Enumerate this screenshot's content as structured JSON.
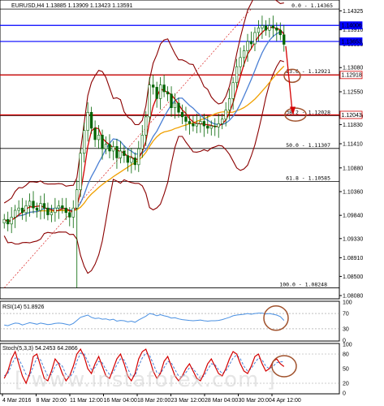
{
  "chart_data": [
    {
      "type": "candlestick",
      "title": "EURUSD,H4  1.13885 1.13909 1.13423 1.13591",
      "ylim": [
        1.0808,
        1.1442
      ],
      "y_ticks": [
        "1.14325",
        "1.13910",
        "1.13590",
        "1.13080",
        "1.12550",
        "1.12020",
        "1.11830",
        "1.11410",
        "1.10880",
        "1.10360",
        "1.09840",
        "1.09330",
        "1.08910",
        "1.08500",
        "1.08080"
      ],
      "x_ticks": [
        "4 Mar 2016",
        "8 Mar 20:00",
        "11 Mar 12:00",
        "16 Mar 04:00",
        "18 Mar 20:00",
        "23 Mar 12:00",
        "28 Mar 04:00",
        "30 Mar 20:00",
        "4 Apr 12:00"
      ],
      "price_labels": [
        {
          "text": "1.14006",
          "value": 1.14006,
          "color": "#0000ff"
        },
        {
          "text": "1.13653",
          "value": 1.13653,
          "color": "#0000ff"
        },
        {
          "text": "1.12918",
          "value": 1.12918,
          "color": "#d40000"
        },
        {
          "text": "1.12043",
          "value": 1.12043,
          "color": "#d40000"
        }
      ],
      "fibonacci_levels": [
        {
          "text": "0.0 - 1.14365",
          "value": 1.14365
        },
        {
          "text": "23.6 - 1.12921",
          "value": 1.12921
        },
        {
          "text": "38.2 - 1.12028",
          "value": 1.12028
        },
        {
          "text": "50.0 - 1.11307",
          "value": 1.11307
        },
        {
          "text": "61.8 - 1.10585",
          "value": 1.10585
        },
        {
          "text": "100.0 - 1.08248",
          "value": 1.08248
        }
      ],
      "candles": {
        "close": [
          1.0975,
          1.0965,
          1.098,
          1.0995,
          1.1,
          1.099,
          1.1005,
          1.1015,
          1.1,
          1.0995,
          1.101,
          1.1,
          1.0985,
          1.099,
          1.1,
          1.1005,
          1.1,
          1.099,
          1.098,
          1.1,
          1.104,
          1.112,
          1.117,
          1.121,
          1.1175,
          1.115,
          1.116,
          1.113,
          1.114,
          1.1125,
          1.1135,
          1.111,
          1.1125,
          1.1115,
          1.11,
          1.111,
          1.1095,
          1.113,
          1.116,
          1.12,
          1.127,
          1.1265,
          1.124,
          1.127,
          1.1255,
          1.125,
          1.122,
          1.123,
          1.121,
          1.12,
          1.119,
          1.1185,
          1.118,
          1.1185,
          1.119,
          1.118,
          1.1175,
          1.118,
          1.1178,
          1.1185,
          1.1195,
          1.1215,
          1.124,
          1.1275,
          1.131,
          1.133,
          1.1345,
          1.1365,
          1.136,
          1.1385,
          1.1395,
          1.14,
          1.139,
          1.14,
          1.1395,
          1.139,
          1.138,
          1.1359
        ],
        "high_low_range": [
          1.0825,
          1.14365
        ]
      },
      "indicators": [
        "Bollinger Bands",
        "Moving averages"
      ],
      "annotations": [
        "circle near 1.1290",
        "circle near 1.1205",
        "down arrow to 1.1205"
      ]
    },
    {
      "type": "line",
      "title": "RSI(14) 51.8926",
      "ylim": [
        0,
        100
      ],
      "y_ticks": [
        "100",
        "70",
        "30",
        "0"
      ],
      "values": [
        40,
        38,
        42,
        45,
        44,
        40,
        43,
        46,
        44,
        42,
        45,
        43,
        41,
        42,
        44,
        45,
        44,
        42,
        40,
        44,
        52,
        60,
        63,
        66,
        60,
        57,
        58,
        55,
        56,
        53,
        55,
        50,
        52,
        51,
        48,
        50,
        47,
        53,
        58,
        63,
        70,
        68,
        64,
        67,
        64,
        62,
        58,
        59,
        56,
        54,
        53,
        52,
        51,
        52,
        53,
        51,
        50,
        51,
        51,
        52,
        54,
        57,
        60,
        64,
        66,
        67,
        68,
        70,
        68,
        70,
        71,
        71,
        69,
        70,
        68,
        66,
        62,
        51.89
      ]
    },
    {
      "type": "line",
      "title": "Stoch(5,3,3) 54.2453 64.2866",
      "ylim": [
        0,
        100
      ],
      "y_ticks": [
        "100",
        "80",
        "50",
        "20",
        "0"
      ],
      "series": [
        {
          "name": "%K",
          "values": [
            30,
            45,
            70,
            85,
            60,
            35,
            20,
            40,
            75,
            80,
            55,
            30,
            25,
            45,
            70,
            60,
            40,
            25,
            35,
            55,
            80,
            90,
            75,
            50,
            40,
            60,
            75,
            55,
            35,
            30,
            50,
            70,
            80,
            60,
            35,
            25,
            40,
            70,
            85,
            90,
            70,
            45,
            30,
            40,
            65,
            75,
            55,
            35,
            25,
            35,
            50,
            60,
            45,
            30,
            25,
            40,
            60,
            70,
            55,
            40,
            35,
            50,
            70,
            85,
            80,
            60,
            45,
            40,
            55,
            75,
            80,
            60,
            45,
            50,
            65,
            70,
            60,
            54.25
          ]
        },
        {
          "name": "%D",
          "values": [
            35,
            40,
            58,
            72,
            70,
            55,
            38,
            35,
            55,
            72,
            68,
            50,
            35,
            38,
            55,
            62,
            55,
            38,
            32,
            42,
            65,
            82,
            80,
            65,
            48,
            52,
            65,
            62,
            48,
            38,
            42,
            58,
            70,
            68,
            50,
            35,
            35,
            55,
            72,
            82,
            78,
            60,
            42,
            40,
            52,
            65,
            62,
            48,
            35,
            32,
            42,
            52,
            50,
            40,
            30,
            35,
            48,
            60,
            58,
            48,
            40,
            45,
            58,
            72,
            78,
            70,
            55,
            45,
            50,
            62,
            72,
            68,
            55,
            50,
            55,
            62,
            64,
            64.29
          ]
        }
      ]
    }
  ],
  "watermark": "[ www.instaforex.com ]",
  "colors": {
    "ma_fast": "#d40000",
    "ma_mid": "#4a7fd4",
    "ma_slow": "#f0a000",
    "bands": "#8b0000",
    "rsi": "#4a90e2",
    "stoch_k": "#d40000",
    "stoch_d": "#4a7fd4",
    "circle": "#a0522d",
    "fib_blue": "#0000ff",
    "fib_red": "#d40000"
  }
}
